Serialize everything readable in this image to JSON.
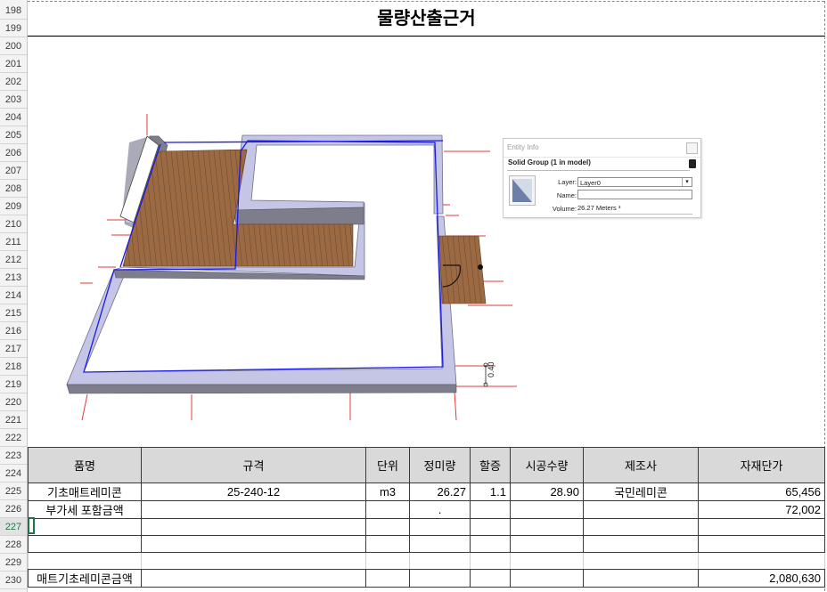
{
  "row_numbers": [
    "198",
    "199",
    "200",
    "201",
    "202",
    "203",
    "204",
    "205",
    "206",
    "207",
    "208",
    "209",
    "210",
    "211",
    "212",
    "213",
    "214",
    "215",
    "216",
    "217",
    "218",
    "219",
    "220",
    "221",
    "222",
    "223",
    "224",
    "225",
    "226",
    "227",
    "228",
    "229",
    "230"
  ],
  "selected_row": "227",
  "sheet": {
    "title": "물량산출근거"
  },
  "entity_info": {
    "title": "Entity Info",
    "group": "Solid Group (1 in model)",
    "layer_label": "Layer:",
    "layer_value": "Layer0",
    "name_label": "Name:",
    "name_value": "",
    "volume_label": "Volume:",
    "volume_value": "26.27 Meters ³"
  },
  "model": {
    "dimension_label": "0.40"
  },
  "table": {
    "headers": [
      "품명",
      "규격",
      "단위",
      "정미량",
      "할증",
      "시공수량",
      "제조사",
      "자재단가"
    ],
    "rows": [
      [
        "기초매트레미콘",
        "25-240-12",
        "m3",
        "26.27",
        "1.1",
        "28.90",
        "국민레미콘",
        "65,456"
      ],
      [
        "부가세 포함금액",
        "",
        "",
        ".",
        "",
        "",
        "",
        "72,002"
      ],
      [
        "",
        "",
        "",
        "",
        "",
        "",
        "",
        ""
      ],
      [
        "",
        "",
        "",
        "",
        "",
        "",
        "",
        ""
      ],
      [
        "",
        "",
        "",
        "",
        "",
        "",
        "",
        ""
      ],
      [
        "매트기초레미콘금액",
        "",
        "",
        "",
        "",
        "",
        "",
        "2,080,630"
      ]
    ]
  }
}
